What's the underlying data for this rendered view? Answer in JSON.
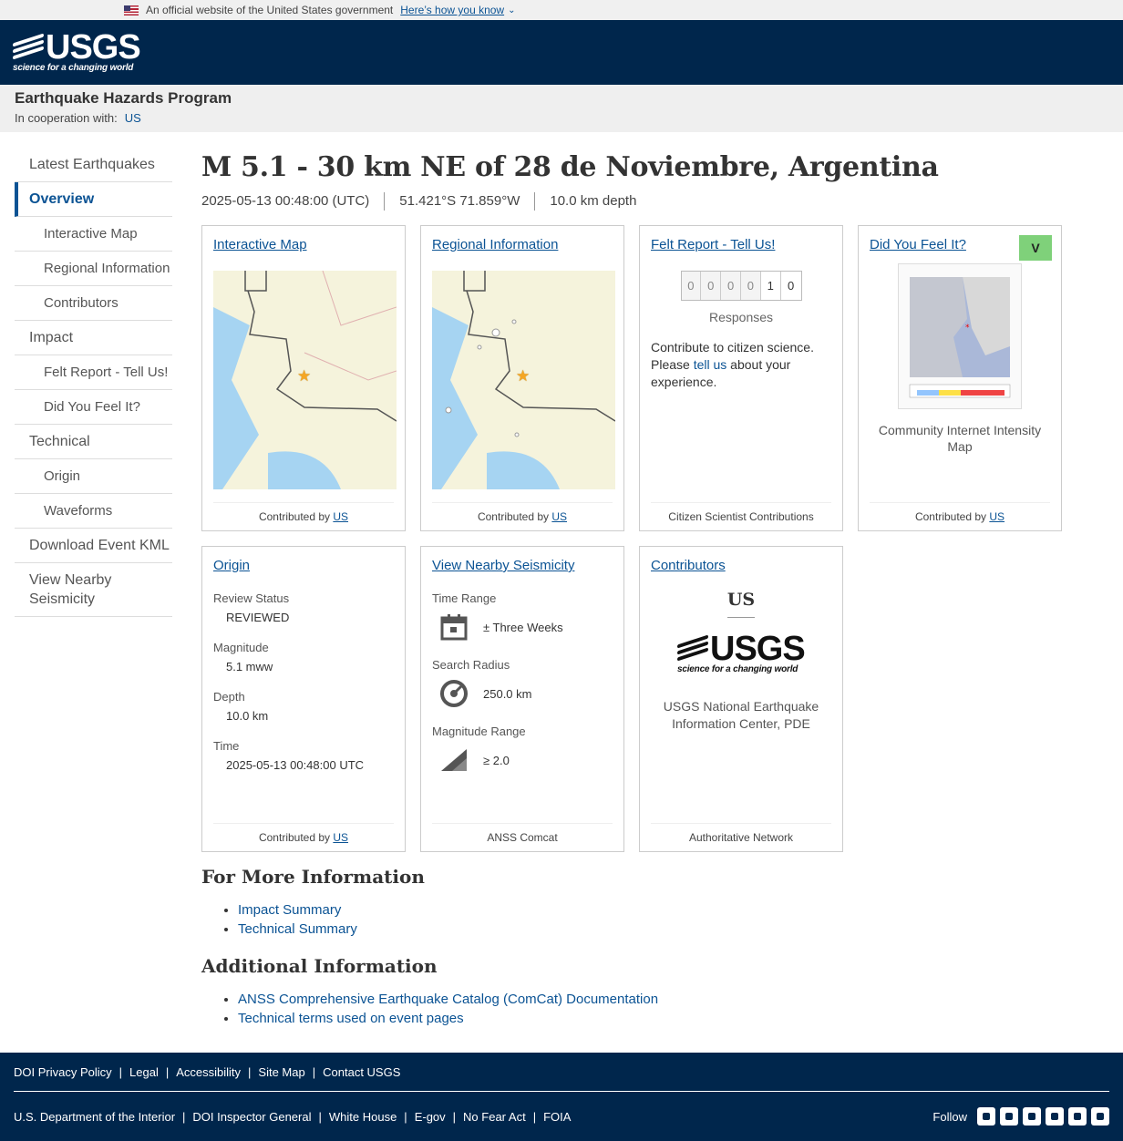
{
  "gov_banner": {
    "text": "An official website of the United States government",
    "link": "Here’s how you know"
  },
  "header": {
    "logo": "USGS",
    "tagline": "science for a changing world"
  },
  "program": {
    "title": "Earthquake Hazards Program",
    "coop_label": "In cooperation with:",
    "coop_link": "US"
  },
  "sidebar": {
    "items": [
      {
        "label": "Latest Earthquakes"
      },
      {
        "label": "Overview"
      },
      {
        "label": "Interactive Map"
      },
      {
        "label": "Regional Information"
      },
      {
        "label": "Contributors"
      },
      {
        "label": "Impact"
      },
      {
        "label": "Felt Report - Tell Us!"
      },
      {
        "label": "Did You Feel It?"
      },
      {
        "label": "Technical"
      },
      {
        "label": "Origin"
      },
      {
        "label": "Waveforms"
      },
      {
        "label": "Download Event KML"
      },
      {
        "label": "View Nearby Seismicity"
      }
    ]
  },
  "event": {
    "title": "M 5.1 - 30 km NE of 28 de Noviembre, Argentina",
    "time": "2025-05-13 00:48:00 (UTC)",
    "location": "51.421°S 71.859°W",
    "depth": "10.0 km depth"
  },
  "cards": {
    "interactive_map": {
      "title": "Interactive Map",
      "foot_text": "Contributed by",
      "foot_link": "US"
    },
    "regional": {
      "title": "Regional Information",
      "foot_text": "Contributed by",
      "foot_link": "US"
    },
    "felt": {
      "title": "Felt Report - Tell Us!",
      "digits": [
        "0",
        "0",
        "0",
        "0",
        "1",
        "0"
      ],
      "responses": "Responses",
      "text_before": "Contribute to citizen science. Please",
      "link": "tell us",
      "text_after": "about your experience.",
      "foot_text": "Citizen Scientist Contributions"
    },
    "dyfi": {
      "title": "Did You Feel It?",
      "badge": "V",
      "caption": "Community Internet Intensity Map",
      "foot_text": "Contributed by",
      "foot_link": "US"
    },
    "origin": {
      "title": "Origin",
      "review_label": "Review Status",
      "review_value": "REVIEWED",
      "mag_label": "Magnitude",
      "mag_value": "5.1 mww",
      "depth_label": "Depth",
      "depth_value": "10.0 km",
      "time_label": "Time",
      "time_value": "2025-05-13 00:48:00 UTC",
      "foot_text": "Contributed by",
      "foot_link": "US"
    },
    "nearby": {
      "title": "View Nearby Seismicity",
      "time_label": "Time Range",
      "time_value": "± Three Weeks",
      "radius_label": "Search Radius",
      "radius_value": "250.0 km",
      "mag_label": "Magnitude Range",
      "mag_value": "≥ 2.0",
      "foot_text": "ANSS Comcat"
    },
    "contributors": {
      "title": "Contributors",
      "code": "US",
      "logo": "USGS",
      "tagline": "science for a changing world",
      "name": "USGS National Earthquake Information Center, PDE",
      "foot_text": "Authoritative Network"
    }
  },
  "more_info": {
    "heading": "For More Information",
    "links": [
      "Impact Summary",
      "Technical Summary"
    ]
  },
  "additional": {
    "heading": "Additional Information",
    "links": [
      "ANSS Comprehensive Earthquake Catalog (ComCat) Documentation",
      "Technical terms used on event pages"
    ]
  },
  "footer": {
    "row1": [
      "DOI Privacy Policy",
      "Legal",
      "Accessibility",
      "Site Map",
      "Contact USGS"
    ],
    "row2": [
      "U.S. Department of the Interior",
      "DOI Inspector General",
      "White House",
      "E-gov",
      "No Fear Act",
      "FOIA"
    ],
    "follow": "Follow",
    "social": [
      "twitter-icon",
      "facebook-icon",
      "github-icon",
      "flickr-icon",
      "youtube-icon",
      "instagram-icon"
    ]
  },
  "colors": {
    "header_bg": "#00264c",
    "link": "#0b5394",
    "badge": "#7fd17a"
  }
}
